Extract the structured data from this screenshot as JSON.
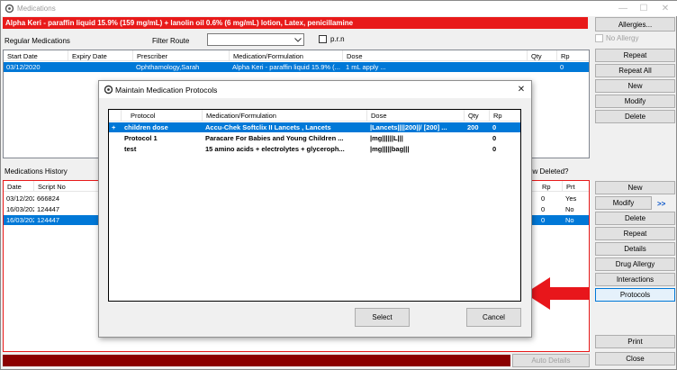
{
  "window": {
    "title": "Medications",
    "minimize": "—",
    "maximize": "☐",
    "close": "✕"
  },
  "alert_bar": "Alpha Keri - paraffin liquid 15.9% (159 mg/mL) + lanolin oil 0.6% (6 mg/mL) lotion, Latex, penicillamine",
  "allergies": {
    "button": "Allergies...",
    "no_allergy_label": "No Allergy",
    "no_allergy_checked": false
  },
  "regular": {
    "title": "Regular Medications",
    "filter_label": "Filter Route",
    "filter_value": "",
    "prn_label": "p.r.n",
    "prn_checked": false,
    "columns": [
      "Start Date",
      "Expiry Date",
      "Prescriber",
      "Medication/Formulation",
      "Dose",
      "Qty",
      "Rp"
    ],
    "rows": [
      [
        "03/12/2020",
        "",
        "Ophthamology,Sarah",
        "Alpha Keri - paraffin liquid 15.9% (...",
        "1 mL apply ...",
        "",
        "0"
      ]
    ],
    "buttons": [
      "Repeat",
      "Repeat All",
      "New",
      "Modify",
      "Delete"
    ]
  },
  "history": {
    "title": "Medications History",
    "show_deleted_label": "ow Deleted?",
    "columns_left": [
      "Date",
      "Script No"
    ],
    "columns_right": [
      "Rp",
      "Prt"
    ],
    "rows": [
      {
        "date": "03/12/2020",
        "script": "666824",
        "rp": "0",
        "prt": "Yes"
      },
      {
        "date": "16/03/2021",
        "script": "124447",
        "rp": "0",
        "prt": "No"
      },
      {
        "date": "16/03/2021",
        "script": "124447",
        "rp": "0",
        "prt": "No"
      }
    ],
    "selected_row": 2,
    "buttons": [
      "New",
      "Modify",
      "Delete",
      "Repeat",
      "Details",
      "Drug Allergy",
      "Interactions",
      "Protocols"
    ],
    "expand_label": ">>",
    "auto_details_label": "Auto Details"
  },
  "footer_buttons": [
    "Print",
    "Close"
  ],
  "dialog": {
    "title": "Maintain Medication Protocols",
    "close": "✕",
    "columns": [
      "Protocol",
      "Medication/Formulation",
      "Dose",
      "Qty",
      "Rp"
    ],
    "rows": [
      {
        "marker": "+",
        "protocol": "children dose",
        "medication": "Accu-Chek Softclix II Lancets , Lancets",
        "dose": "|Lancets||||200||/ [200] ...",
        "qty": "200",
        "rp": "0"
      },
      {
        "marker": "",
        "protocol": "Protocol 1",
        "medication": "Paracare For Babies and Young Children ...",
        "dose": "|mg||||||L|||",
        "qty": "",
        "rp": "0"
      },
      {
        "marker": "",
        "protocol": "test",
        "medication": "15 amino acids + electrolytes + glyceroph...",
        "dose": "|mg|||||bag|||",
        "qty": "",
        "rp": "0"
      }
    ],
    "selected_row": 0,
    "select_button": "Select",
    "cancel_button": "Cancel"
  },
  "colors": {
    "alert": "#e81a1a",
    "selection": "#0078d7",
    "arrow": "#e8161b",
    "history_bar": "#8b0000"
  }
}
